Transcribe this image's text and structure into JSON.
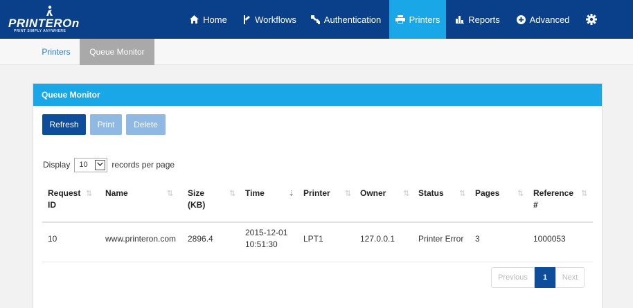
{
  "brand": {
    "name": "PRINTEROn",
    "tagline": "PRINT SIMPLY ANYWHERE"
  },
  "nav": {
    "items": [
      {
        "label": "Home",
        "icon": "home-icon"
      },
      {
        "label": "Workflows",
        "icon": "workflow-icon"
      },
      {
        "label": "Authentication",
        "icon": "key-icon"
      },
      {
        "label": "Printers",
        "icon": "printer-icon",
        "active": true
      },
      {
        "label": "Reports",
        "icon": "bar-chart-icon"
      },
      {
        "label": "Advanced",
        "icon": "plus-circle-icon"
      }
    ],
    "settings_icon": "gear-icon"
  },
  "subnav": {
    "tabs": [
      {
        "label": "Printers"
      },
      {
        "label": "Queue Monitor",
        "active": true
      }
    ]
  },
  "panel": {
    "title": "Queue Monitor",
    "buttons": {
      "refresh": "Refresh",
      "print": "Print",
      "delete": "Delete"
    },
    "display": {
      "prefix": "Display",
      "value": "10",
      "suffix": "records per page"
    }
  },
  "table": {
    "columns": [
      {
        "line1": "Request",
        "line2": "ID"
      },
      {
        "line1": "Name",
        "line2": ""
      },
      {
        "line1": "Size",
        "line2": "(KB)"
      },
      {
        "line1": "Time",
        "line2": ""
      },
      {
        "line1": "Printer",
        "line2": ""
      },
      {
        "line1": "Owner",
        "line2": ""
      },
      {
        "line1": "Status",
        "line2": ""
      },
      {
        "line1": "Pages",
        "line2": ""
      },
      {
        "line1": "Reference",
        "line2": "#"
      }
    ],
    "rows": [
      {
        "request_id": "10",
        "name": "www.printeron.com",
        "size": "2896.4",
        "time_date": "2015-12-01",
        "time_clock": "10:51:30",
        "printer": "LPT1",
        "owner": "127.0.0.1",
        "status": "Printer Error",
        "pages": "3",
        "reference": "1000053"
      }
    ]
  },
  "pagination": {
    "previous": "Previous",
    "current": "1",
    "next": "Next"
  },
  "colors": {
    "navbar": "#0a3f8a",
    "accent": "#1aa7e8",
    "primary_button": "#0d4d9a",
    "disabled_button": "#8fb8e3"
  }
}
